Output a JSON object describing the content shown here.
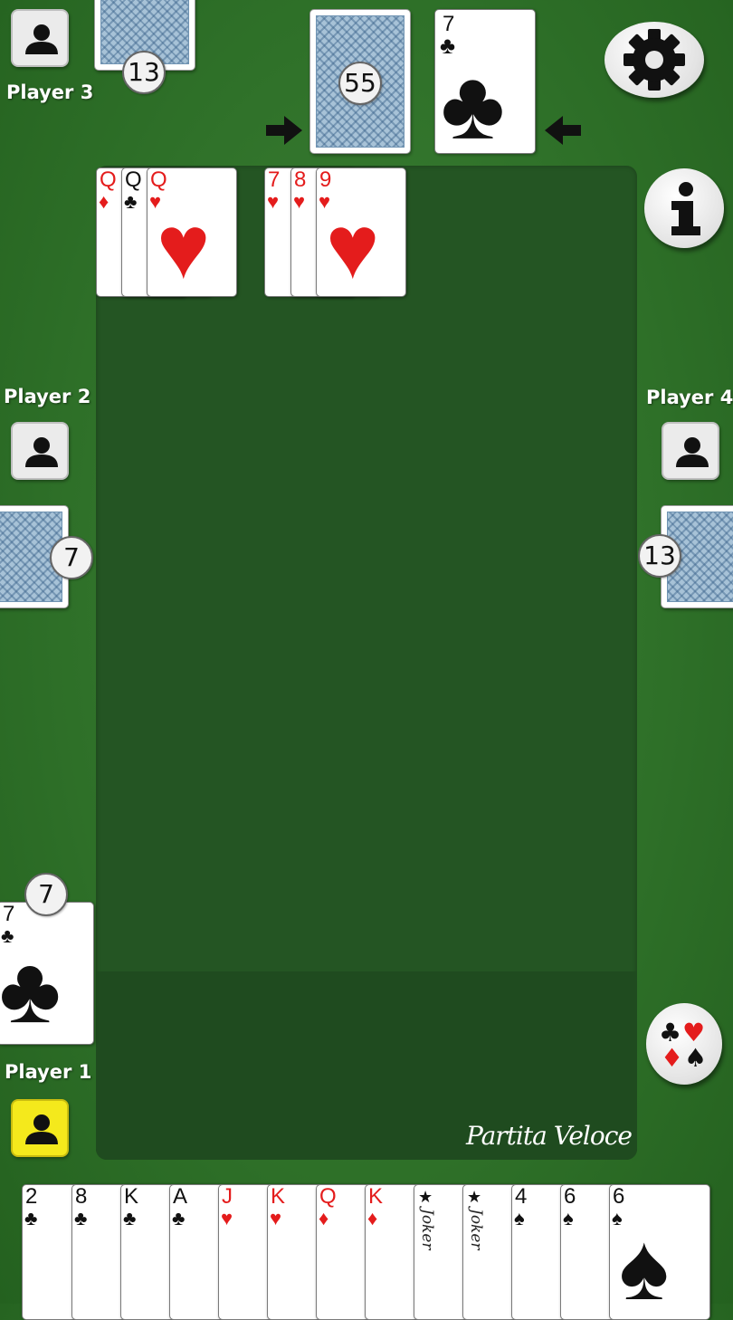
{
  "players": {
    "p1": {
      "name": "Player 1",
      "meld_count": "7"
    },
    "p2": {
      "name": "Player 2",
      "count": "7"
    },
    "p3": {
      "name": "Player 3",
      "count": "13"
    },
    "p4": {
      "name": "Player 4",
      "count": "13"
    }
  },
  "deck": {
    "count": "55"
  },
  "discard_top": {
    "rank": "7",
    "suit": "♣"
  },
  "melds": [
    {
      "cards": [
        {
          "rank": "Q",
          "suit": "♦"
        },
        {
          "rank": "Q",
          "suit": "♣"
        },
        {
          "rank": "Q",
          "suit": "♥"
        }
      ]
    },
    {
      "cards": [
        {
          "rank": "7",
          "suit": "♥"
        },
        {
          "rank": "8",
          "suit": "♥"
        },
        {
          "rank": "9",
          "suit": "♥"
        }
      ]
    }
  ],
  "player1_last": {
    "rank": "7",
    "suit": "♣"
  },
  "hand": [
    {
      "rank": "2",
      "suit": "♣"
    },
    {
      "rank": "8",
      "suit": "♣"
    },
    {
      "rank": "K",
      "suit": "♣"
    },
    {
      "rank": "A",
      "suit": "♣"
    },
    {
      "rank": "J",
      "suit": "♥"
    },
    {
      "rank": "K",
      "suit": "♥"
    },
    {
      "rank": "Q",
      "suit": "♦"
    },
    {
      "rank": "K",
      "suit": "♦"
    },
    {
      "rank": "Joker",
      "suit": "★"
    },
    {
      "rank": "Joker",
      "suit": "★"
    },
    {
      "rank": "4",
      "suit": "♠"
    },
    {
      "rank": "6",
      "suit": "♠"
    },
    {
      "rank": "6",
      "suit": "♠"
    }
  ],
  "mode_label": "Partita Veloce",
  "icons": {
    "settings": "gear-icon",
    "info": "info-icon",
    "suits": "card-suits-icon",
    "avatar": "user-icon",
    "arrow": "arrow-icon"
  },
  "colors": {
    "felt": "#2f7129",
    "table": "#245523",
    "active_player": "#f4e91c",
    "red_suit": "#e41c1c"
  }
}
